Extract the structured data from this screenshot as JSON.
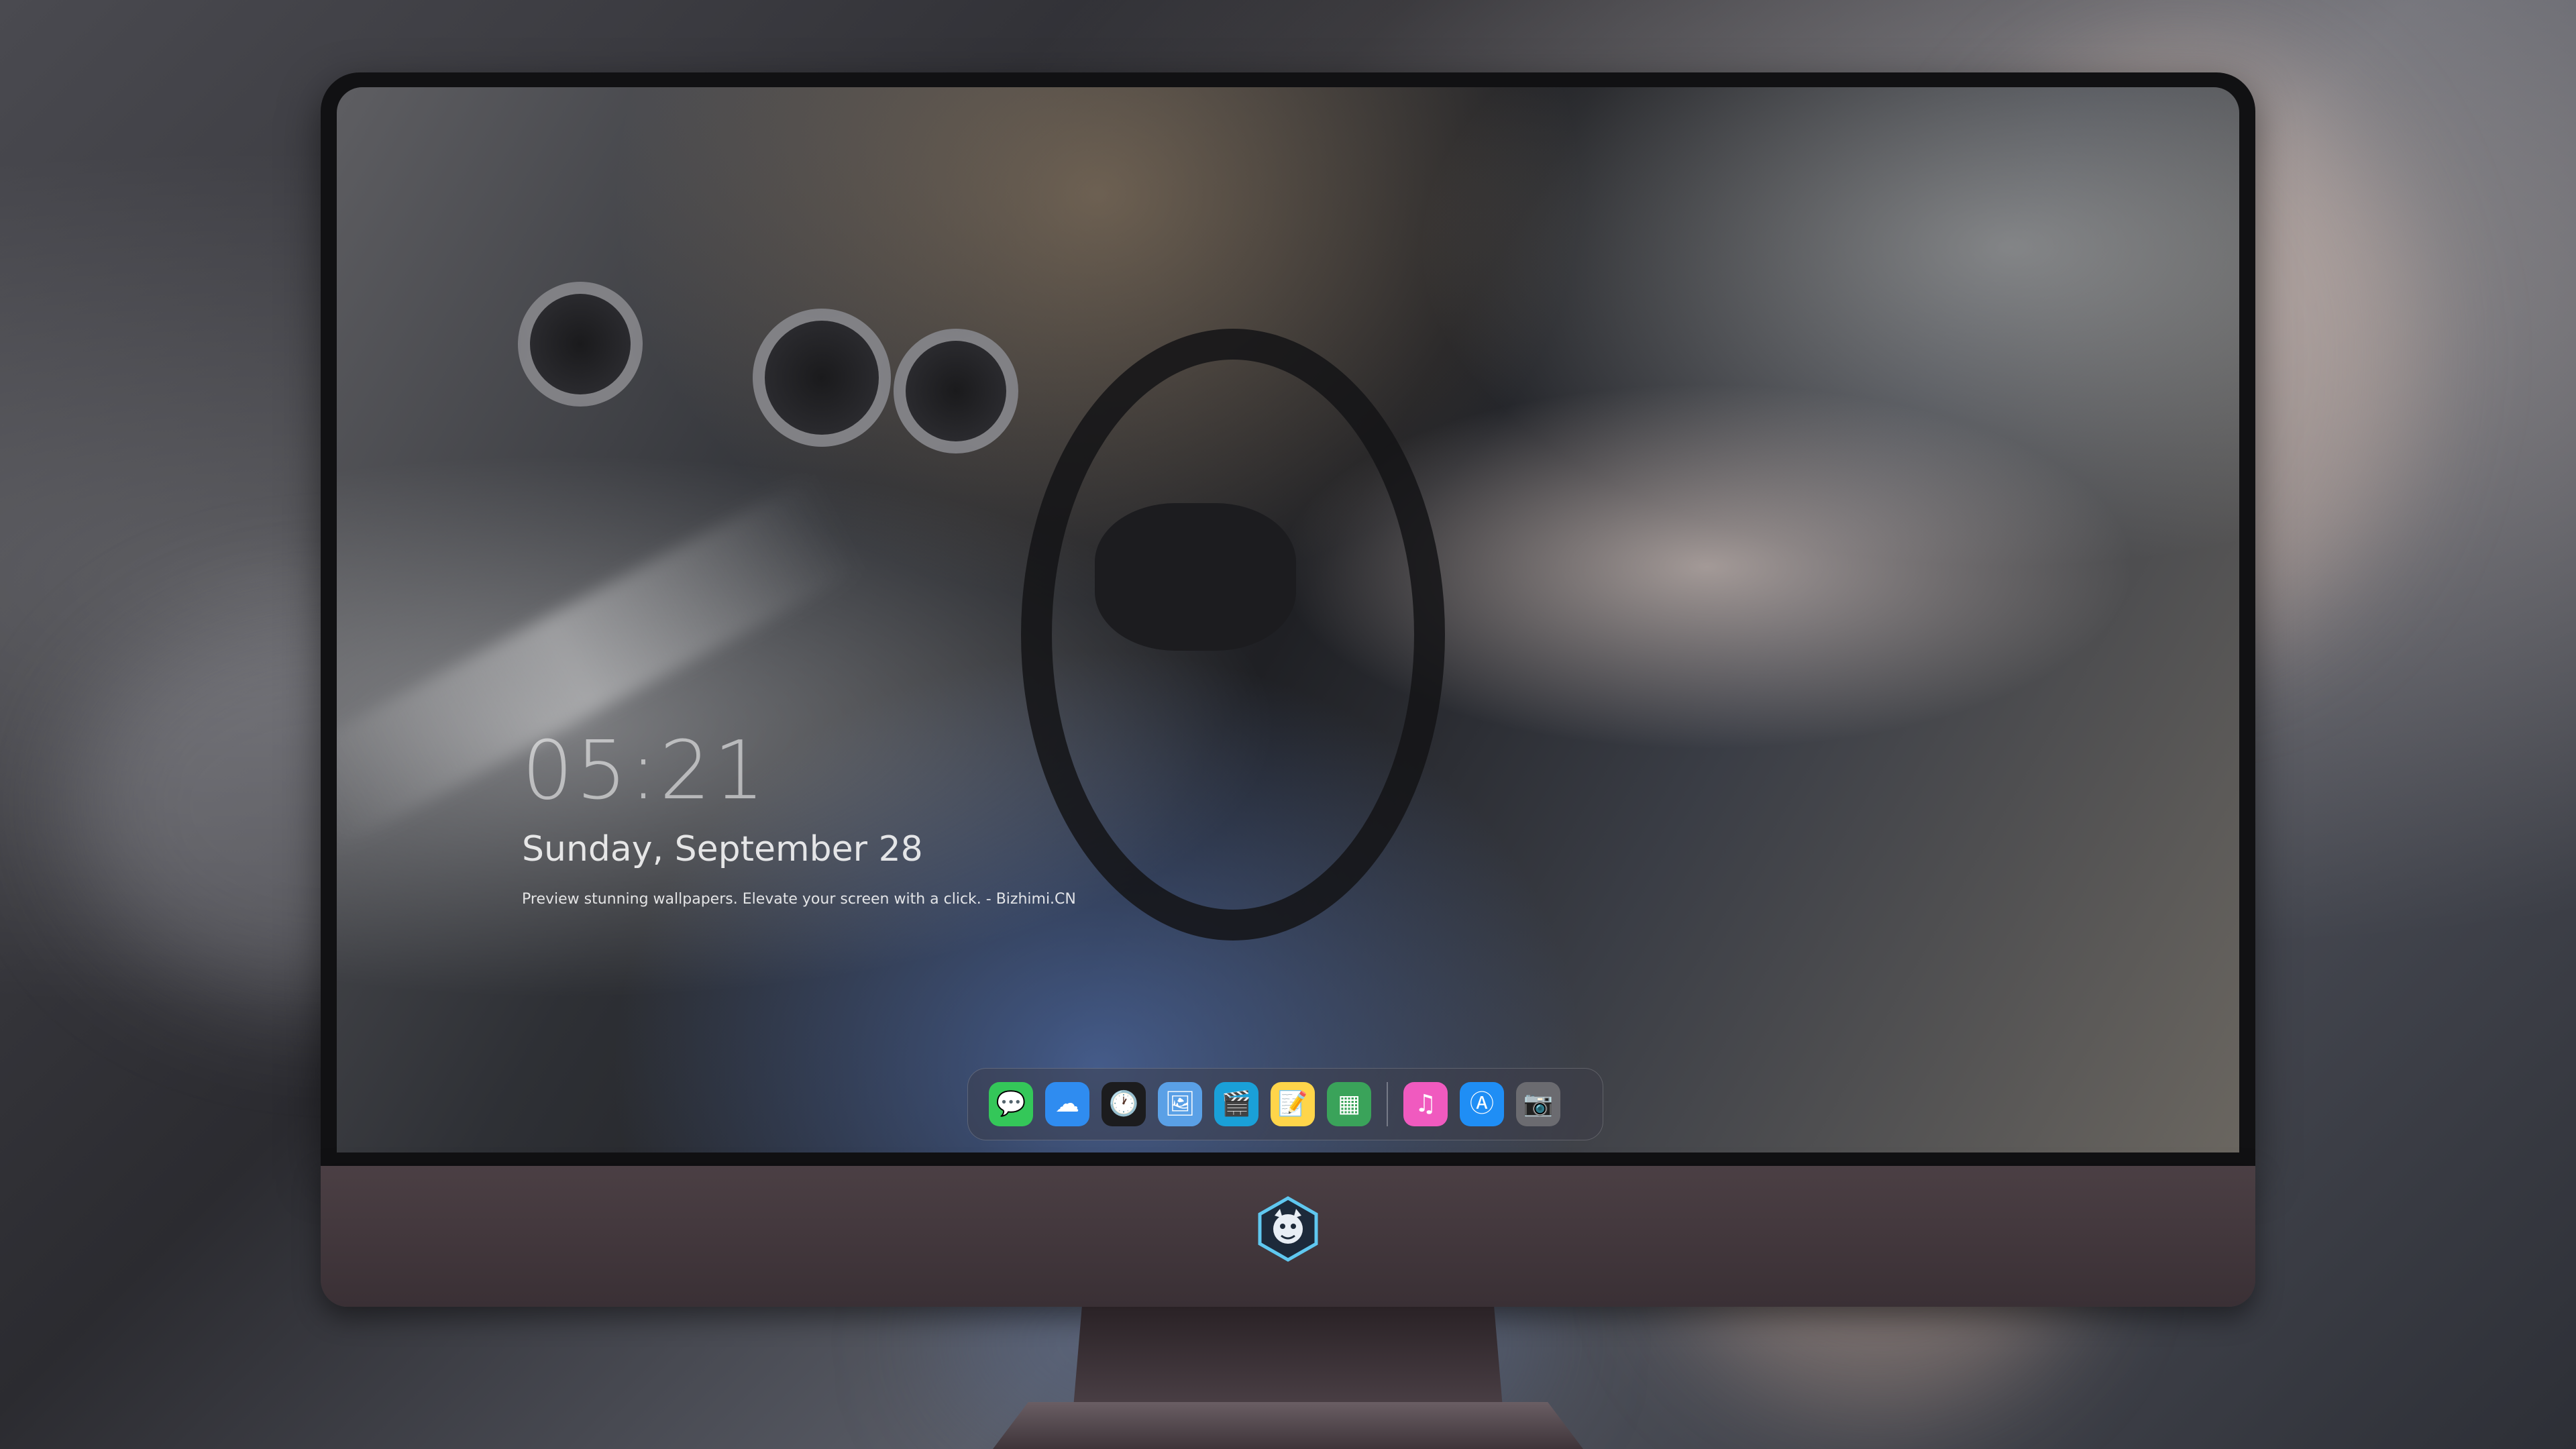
{
  "lock_screen": {
    "time": "05:21",
    "date": "Sunday, September 28",
    "caption": "Preview stunning wallpapers. Elevate your screen with a click. - Bizhimi.CN"
  },
  "dock": {
    "apps": [
      {
        "name": "messages-icon",
        "glyph": "💬",
        "color": "#34c759"
      },
      {
        "name": "weather-icon",
        "glyph": "☁",
        "color": "#2f8cf0"
      },
      {
        "name": "clock-icon",
        "glyph": "🕐",
        "color": "#1c1c1e"
      },
      {
        "name": "preview-icon",
        "glyph": "🖼",
        "color": "#5aa0e6"
      },
      {
        "name": "clips-icon",
        "glyph": "🎬",
        "color": "#1aa0d8"
      },
      {
        "name": "notes-icon",
        "glyph": "📝",
        "color": "#ffd54a"
      },
      {
        "name": "photo-booth-icon",
        "glyph": "▦",
        "color": "#3aa35a"
      },
      {
        "name": "music-icon",
        "glyph": "♫",
        "color": "#f05abf"
      },
      {
        "name": "app-store-icon",
        "glyph": "Ⓐ",
        "color": "#1f8ef5"
      },
      {
        "name": "screenshot-icon",
        "glyph": "📷",
        "color": "#6b6b70"
      }
    ]
  },
  "colors": {
    "chin": "#4b3f44",
    "bezel": "#111113"
  }
}
